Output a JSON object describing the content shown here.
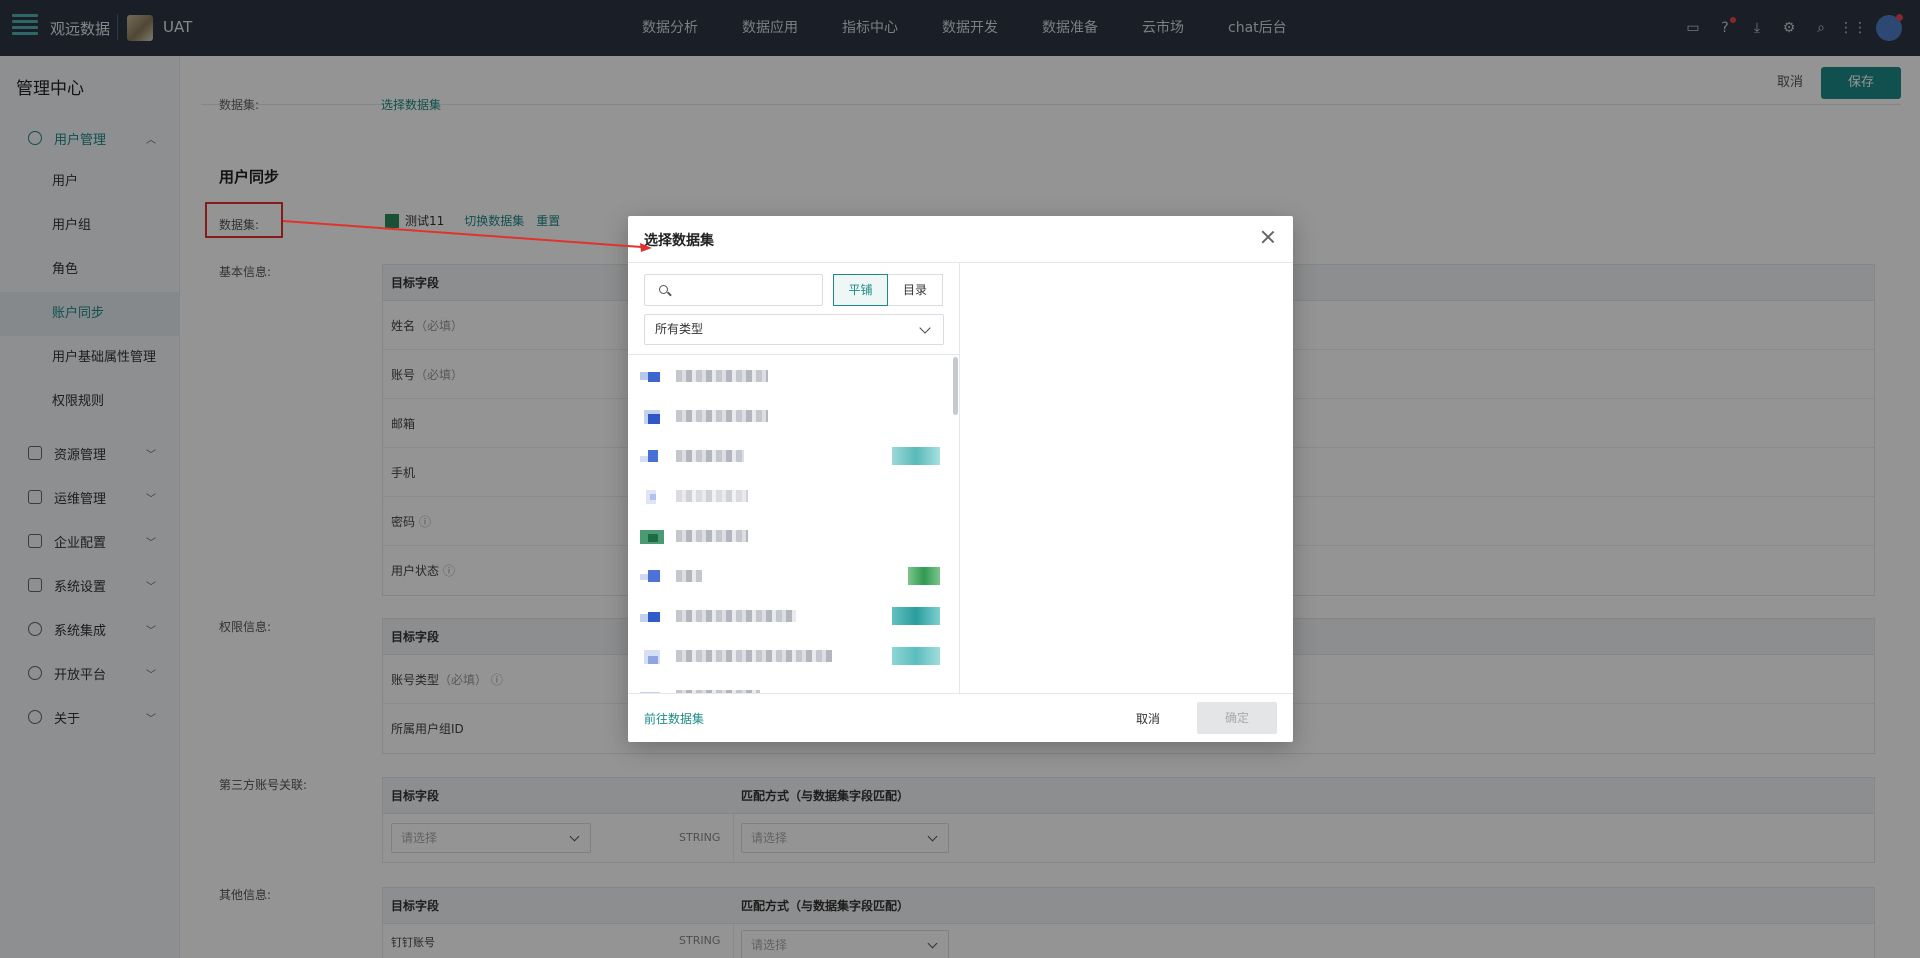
{
  "topbar": {
    "brand": "观远数据",
    "workspace": "UAT",
    "nav": [
      "数据分析",
      "数据应用",
      "指标中心",
      "数据开发",
      "数据准备",
      "云市场",
      "chat后台"
    ]
  },
  "sidebar": {
    "title": "管理中心",
    "user_mgmt": "用户管理",
    "subitems": [
      "用户",
      "用户组",
      "角色",
      "账户同步",
      "用户基础属性管理",
      "权限规则"
    ],
    "groups": [
      "资源管理",
      "运维管理",
      "企业配置",
      "系统设置",
      "系统集成",
      "开放平台",
      "关于"
    ]
  },
  "main": {
    "cancel": "取消",
    "save": "保存",
    "cut_label": "数据集:",
    "cut_link": "选择数据集",
    "section_title": "用户同步",
    "dataset_label": "数据集:",
    "dataset_name": "测试11",
    "switch_dataset": "切换数据集",
    "reset": "重置",
    "basic_label": "基本信息:",
    "perm_label": "权限信息:",
    "third_label": "第三方账号关联:",
    "other_label": "其他信息:",
    "target_field": "目标字段",
    "match_header": "匹配方式（与数据集字段匹配）",
    "basic_rows": [
      {
        "name": "姓名",
        "hint": "（必填）"
      },
      {
        "name": "账号",
        "hint": "（必填）"
      },
      {
        "name": "邮箱",
        "hint": ""
      },
      {
        "name": "手机",
        "hint": ""
      },
      {
        "name": "密码",
        "hint": "ⓘ"
      },
      {
        "name": "用户状态",
        "hint": "ⓘ"
      }
    ],
    "perm_rows": [
      {
        "name": "账号类型",
        "hint": "（必填）  ⓘ"
      },
      {
        "name": "所属用户组ID",
        "hint": ""
      }
    ],
    "select_placeholder": "请选择",
    "string_type": "STRING",
    "other_row_name": "钉钉账号"
  },
  "modal": {
    "title": "选择数据集",
    "search_placeholder": "",
    "view_flat": "平铺",
    "view_dir": "目录",
    "type_filter": "所有类型",
    "goto": "前往数据集",
    "cancel": "取消",
    "ok": "确定"
  },
  "colors": {
    "accent": "#1d8a87",
    "annotation_red": "#e0332e",
    "topbar_bg": "#2b3544"
  }
}
